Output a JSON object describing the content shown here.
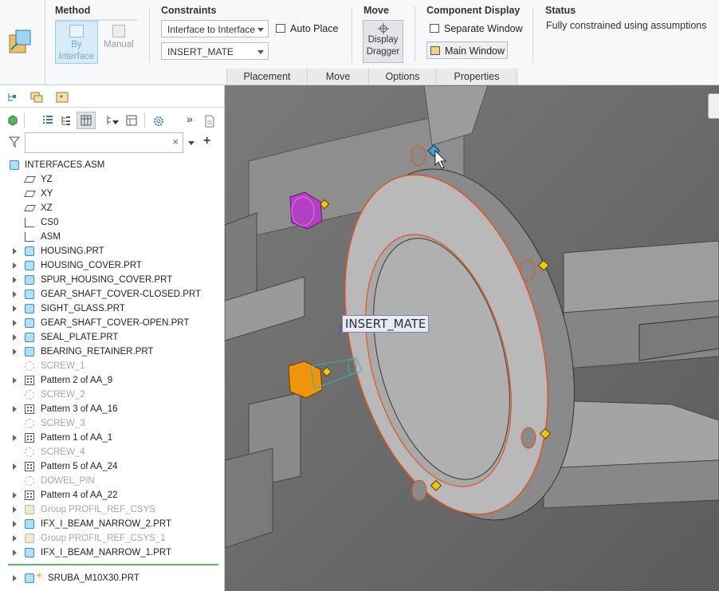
{
  "ribbon": {
    "method": {
      "title": "Method",
      "by_interface": "By\nInterface",
      "manual": "Manual"
    },
    "constraints": {
      "title": "Constraints",
      "interface_dropdown": "Interface to Interface",
      "mate_dropdown": "INSERT_MATE",
      "auto_place": "Auto Place"
    },
    "move": {
      "title": "Move",
      "display_dragger": "Display\nDragger"
    },
    "component_display": {
      "title": "Component Display",
      "separate_window": "Separate Window",
      "main_window": "Main Window"
    },
    "status": {
      "title": "Status",
      "text": "Fully constrained using assumptions"
    },
    "tabs": [
      "Placement",
      "Move",
      "Options",
      "Properties"
    ]
  },
  "tree": {
    "root": "INTERFACES.ASM",
    "items": [
      {
        "label": "YZ",
        "icon": "plane",
        "expandable": false,
        "dim": false
      },
      {
        "label": "XY",
        "icon": "plane",
        "expandable": false,
        "dim": false
      },
      {
        "label": "XZ",
        "icon": "plane",
        "expandable": false,
        "dim": false
      },
      {
        "label": "CS0",
        "icon": "csys",
        "expandable": false,
        "dim": false
      },
      {
        "label": "ASM",
        "icon": "csys",
        "expandable": false,
        "dim": false
      },
      {
        "label": "HOUSING.PRT",
        "icon": "part",
        "expandable": true,
        "dim": false
      },
      {
        "label": "HOUSING_COVER.PRT",
        "icon": "part",
        "expandable": true,
        "dim": false
      },
      {
        "label": "SPUR_HOUSING_COVER.PRT",
        "icon": "part",
        "expandable": true,
        "dim": false
      },
      {
        "label": "GEAR_SHAFT_COVER-CLOSED.PRT",
        "icon": "part",
        "expandable": true,
        "dim": false
      },
      {
        "label": "SIGHT_GLASS.PRT",
        "icon": "part",
        "expandable": true,
        "dim": false
      },
      {
        "label": "GEAR_SHAFT_COVER-OPEN.PRT",
        "icon": "part",
        "expandable": true,
        "dim": false
      },
      {
        "label": "SEAL_PLATE.PRT",
        "icon": "part",
        "expandable": true,
        "dim": false
      },
      {
        "label": "BEARING_RETAINER.PRT",
        "icon": "part",
        "expandable": true,
        "dim": false
      },
      {
        "label": "SCREW_1",
        "icon": "screw",
        "expandable": false,
        "dim": true
      },
      {
        "label": "Pattern 2 of AA_9",
        "icon": "pattern",
        "expandable": true,
        "dim": false
      },
      {
        "label": "SCREW_2",
        "icon": "screw",
        "expandable": false,
        "dim": true
      },
      {
        "label": "Pattern 3 of AA_16",
        "icon": "pattern",
        "expandable": true,
        "dim": false
      },
      {
        "label": "SCREW_3",
        "icon": "screw",
        "expandable": false,
        "dim": true
      },
      {
        "label": "Pattern 1 of AA_1",
        "icon": "pattern",
        "expandable": true,
        "dim": false
      },
      {
        "label": "SCREW_4",
        "icon": "screw",
        "expandable": false,
        "dim": true
      },
      {
        "label": "Pattern 5 of AA_24",
        "icon": "pattern",
        "expandable": true,
        "dim": false
      },
      {
        "label": "DOWEL_PIN",
        "icon": "screw",
        "expandable": false,
        "dim": true
      },
      {
        "label": "Pattern 4 of AA_22",
        "icon": "pattern",
        "expandable": true,
        "dim": false
      },
      {
        "label": "Group PROFIL_REF_CSYS",
        "icon": "group",
        "expandable": true,
        "dim": true
      },
      {
        "label": "IFX_I_BEAM_NARROW_2.PRT",
        "icon": "part",
        "expandable": true,
        "dim": false
      },
      {
        "label": "Group PROFIL_REF_CSYS_1",
        "icon": "group",
        "expandable": true,
        "dim": true
      },
      {
        "label": "IFX_I_BEAM_NARROW_1.PRT",
        "icon": "part",
        "expandable": true,
        "dim": false
      }
    ],
    "new_component": "SRUBA_M10X30.PRT"
  },
  "viewport": {
    "constraint_label": "INSERT_MATE"
  },
  "colors": {
    "accent_blue": "#3a90c2",
    "edge_orange": "#e0541c",
    "bolt_purple": "#b23fc4",
    "bolt_orange": "#f0940e",
    "marker_yellow": "#f2c41a"
  }
}
